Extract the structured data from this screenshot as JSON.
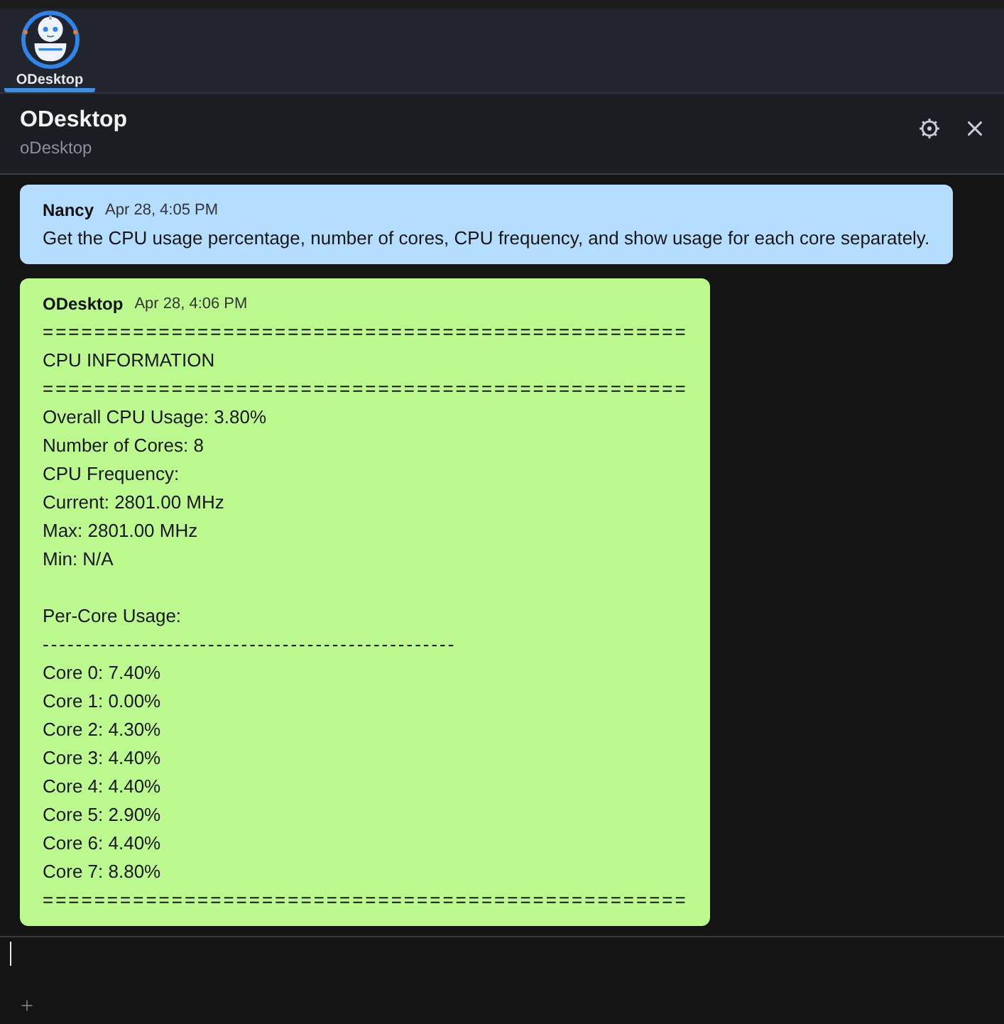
{
  "app_bar": {
    "apps": [
      {
        "label": "ODesktop",
        "selected": true
      }
    ]
  },
  "header": {
    "title": "ODesktop",
    "subtitle": "oDesktop"
  },
  "messages": [
    {
      "kind": "user",
      "sender": "Nancy",
      "time": "Apr 28, 4:05 PM",
      "lines": [
        {
          "kind": "text",
          "text": "Get the CPU usage percentage, number of cores, CPU frequency, and show usage for each core separately."
        }
      ]
    },
    {
      "kind": "bot",
      "sender": "ODesktop",
      "time": "Apr 28, 4:06 PM",
      "lines": [
        {
          "kind": "rule",
          "text": "=================================================="
        },
        {
          "kind": "text",
          "text": "CPU INFORMATION"
        },
        {
          "kind": "rule",
          "text": "=================================================="
        },
        {
          "kind": "text",
          "text": "Overall CPU Usage: 3.80%"
        },
        {
          "kind": "text",
          "text": "Number of Cores: 8"
        },
        {
          "kind": "text",
          "text": "CPU Frequency:"
        },
        {
          "kind": "text",
          "text": "Current: 2801.00 MHz"
        },
        {
          "kind": "text",
          "text": "Max: 2801.00 MHz"
        },
        {
          "kind": "text",
          "text": "Min: N/A"
        },
        {
          "kind": "blank"
        },
        {
          "kind": "text",
          "text": "Per-Core Usage:"
        },
        {
          "kind": "rule",
          "text": "--------------------------------------------------"
        },
        {
          "kind": "text",
          "text": "Core 0: 7.40%"
        },
        {
          "kind": "text",
          "text": "Core 1: 0.00%"
        },
        {
          "kind": "text",
          "text": "Core 2: 4.30%"
        },
        {
          "kind": "text",
          "text": "Core 3: 4.40%"
        },
        {
          "kind": "text",
          "text": "Core 4: 4.40%"
        },
        {
          "kind": "text",
          "text": "Core 5: 2.90%"
        },
        {
          "kind": "text",
          "text": "Core 6: 4.40%"
        },
        {
          "kind": "text",
          "text": "Core 7: 8.80%"
        },
        {
          "kind": "rule",
          "text": "=================================================="
        }
      ]
    }
  ]
}
